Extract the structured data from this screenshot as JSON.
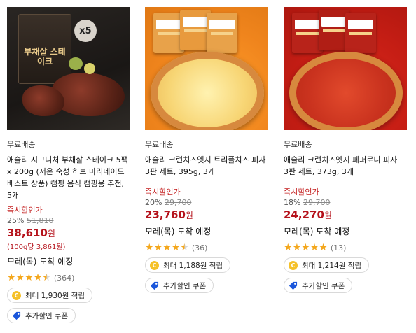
{
  "products": [
    {
      "free_shipping": "무료배송",
      "title": "애슐리 시그니처 부채살 스테이크 5팩 x 200g (저온 숙성 허브 마리네이드 베스트 상품) 캠핑 음식 캠핑용 추천, 5개",
      "image_text": {
        "badge": "x5",
        "pack_title": "부채살 스테이크"
      },
      "instant_discount_label": "즉시할인가",
      "discount_percent": "25%",
      "original_price": "51,810",
      "price": "38,610",
      "price_unit": "원",
      "unit_price": "(100g당 3,861원)",
      "arrival": "모레(목) 도착 예정",
      "rating": 4.5,
      "review_count": "(364)",
      "points": "최대 1,930원 적립",
      "coupon": "추가할인 쿠폰"
    },
    {
      "free_shipping": "무료배송",
      "title": "애슐리 크런치즈엣지 트리플치즈 피자 3판 세트, 395g, 3개",
      "instant_discount_label": "즉시할인가",
      "discount_percent": "20%",
      "original_price": "29,700",
      "price": "23,760",
      "price_unit": "원",
      "arrival": "모레(목) 도착 예정",
      "rating": 4.5,
      "review_count": "(36)",
      "points": "최대 1,188원 적립",
      "coupon": "추가할인 쿠폰"
    },
    {
      "free_shipping": "무료배송",
      "title": "애슐리 크런치즈엣지 페퍼로니 피자 3판 세트, 373g, 3개",
      "instant_discount_label": "즉시할인가",
      "discount_percent": "18%",
      "original_price": "29,700",
      "price": "24,270",
      "price_unit": "원",
      "arrival": "모레(목) 도착 예정",
      "rating": 5,
      "review_count": "(13)",
      "points": "최대 1,214원 적립",
      "coupon": "추가할인 쿠폰"
    }
  ],
  "colors": {
    "price": "#b5121b",
    "star": "#f4a71c",
    "coin": "#f5c12a",
    "coupon_icon": "#1a56db"
  },
  "icons": {
    "star": "star-icon",
    "coin": "coin-icon",
    "coupon": "coupon-tag-icon"
  }
}
